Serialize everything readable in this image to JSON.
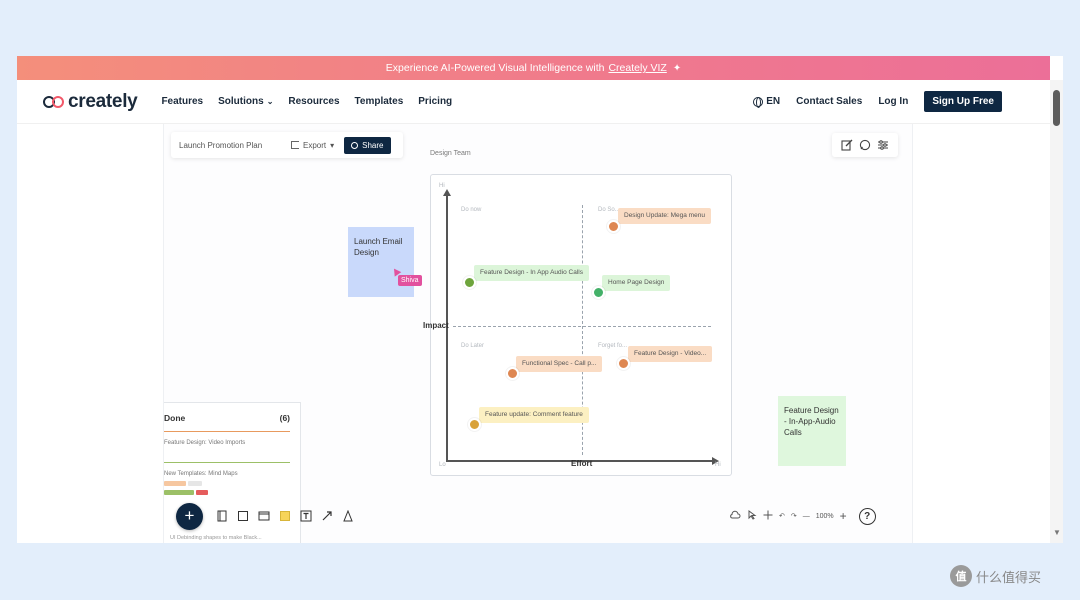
{
  "promo_banner": {
    "text": "Experience AI-Powered Visual Intelligence with",
    "link": "Creately VIZ"
  },
  "nav": {
    "logo": "creately",
    "links": [
      "Features",
      "Solutions",
      "Resources",
      "Templates",
      "Pricing"
    ],
    "language": "EN",
    "contact_sales": "Contact Sales",
    "login": "Log In",
    "signup": "Sign Up Free"
  },
  "doc_toolbar": {
    "title": "Launch Promotion Plan",
    "export_label": "Export",
    "share_label": "Share"
  },
  "matrix": {
    "label": "Design Team",
    "corner_top": "Hi",
    "corner_bottom_left": "Lo",
    "corner_bottom_right": "Hi",
    "quadrants": [
      "Do now",
      "Do So...",
      "Do Later",
      "Forget fo..."
    ],
    "axis_y": "Impact",
    "axis_x": "Effort",
    "tags": [
      {
        "text": "Design Update: Mega menu"
      },
      {
        "text": "Feature Design - In App Audio Calls"
      },
      {
        "text": "Home Page Design"
      },
      {
        "text": "Functional Spec - Call p..."
      },
      {
        "text": "Feature Design - Video..."
      },
      {
        "text": "Feature update: Comment feature"
      }
    ]
  },
  "stickies": {
    "blue": "Launch Email Design",
    "green": "Feature Design - In-App-Audio Calls"
  },
  "cursor_label": "Shiva",
  "done_panel": {
    "title": "Done",
    "count": "(6)",
    "item1": "Feature Design: Video Imports",
    "item2": "New Templates: Mind Maps",
    "footer": "UI Debinding shapes to make Black..."
  },
  "zoom": {
    "level": "100%"
  },
  "watermark": {
    "badge": "值",
    "text": "什么值得买"
  },
  "colors": {
    "brand_dark": "#0e2742",
    "promo_start": "#f48f7b",
    "promo_end": "#ec6f98",
    "page_bg": "#e3eefb"
  }
}
